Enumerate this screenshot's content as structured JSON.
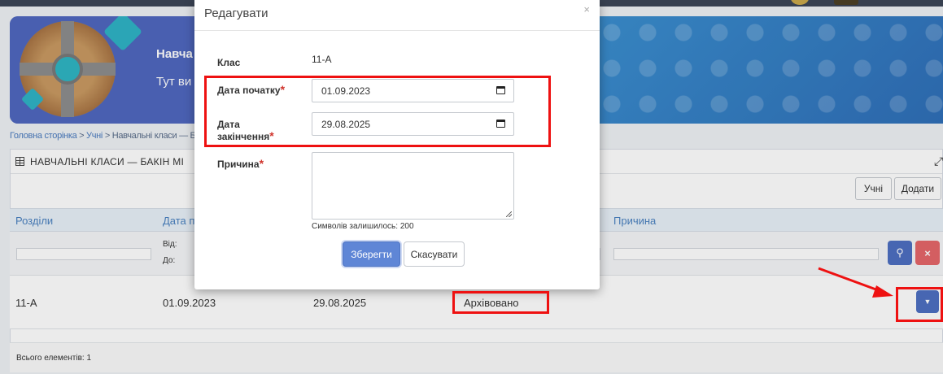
{
  "banner": {
    "title": "Навча",
    "subtitle": "Тут ви"
  },
  "breadcrumb": {
    "home": "Головна сторінка",
    "sep1": " > ",
    "students": "Учні",
    "sep2": " > ",
    "current": "Навчальні класи — Ба"
  },
  "panel": {
    "title": "НАВЧАЛЬНІ КЛАСИ — БАКІН МІ",
    "toolbar": {
      "students_label": "Учні",
      "add_label": "Додати"
    }
  },
  "table": {
    "headers": {
      "sections": "Розділи",
      "start_date": "Дата п",
      "reason": "Причина"
    },
    "filter": {
      "from_label": "Від:",
      "to_label": "До:"
    },
    "rows": [
      {
        "class": "11-А",
        "start": "01.09.2023",
        "end": "29.08.2025",
        "status": "Архівовано"
      }
    ],
    "total_label": "Всього елементів: 1"
  },
  "modal": {
    "title": "Редагувати",
    "close": "×",
    "class_label": "Клас",
    "class_value": "11-А",
    "start_label": "Дата початку",
    "start_value": "01.09.2023",
    "end_label_line1": "Дата",
    "end_label_line2": "закінчення",
    "end_value": "29.08.2025",
    "reason_label": "Причина",
    "required_mark": "*",
    "chars_left": "Символів залишилось: 200",
    "save_label": "Зберегти",
    "cancel_label": "Скасувати"
  },
  "icons": {
    "search": "search-icon",
    "clear": "close-icon",
    "calendar": "calendar-icon",
    "grid": "grid-icon",
    "expand": "expand-icon",
    "dropdown": "caret-down-icon"
  },
  "colors": {
    "primary": "#4e6fc2",
    "danger": "#e5666a",
    "annotation": "#ee1111",
    "header_text": "#4a82c0"
  }
}
